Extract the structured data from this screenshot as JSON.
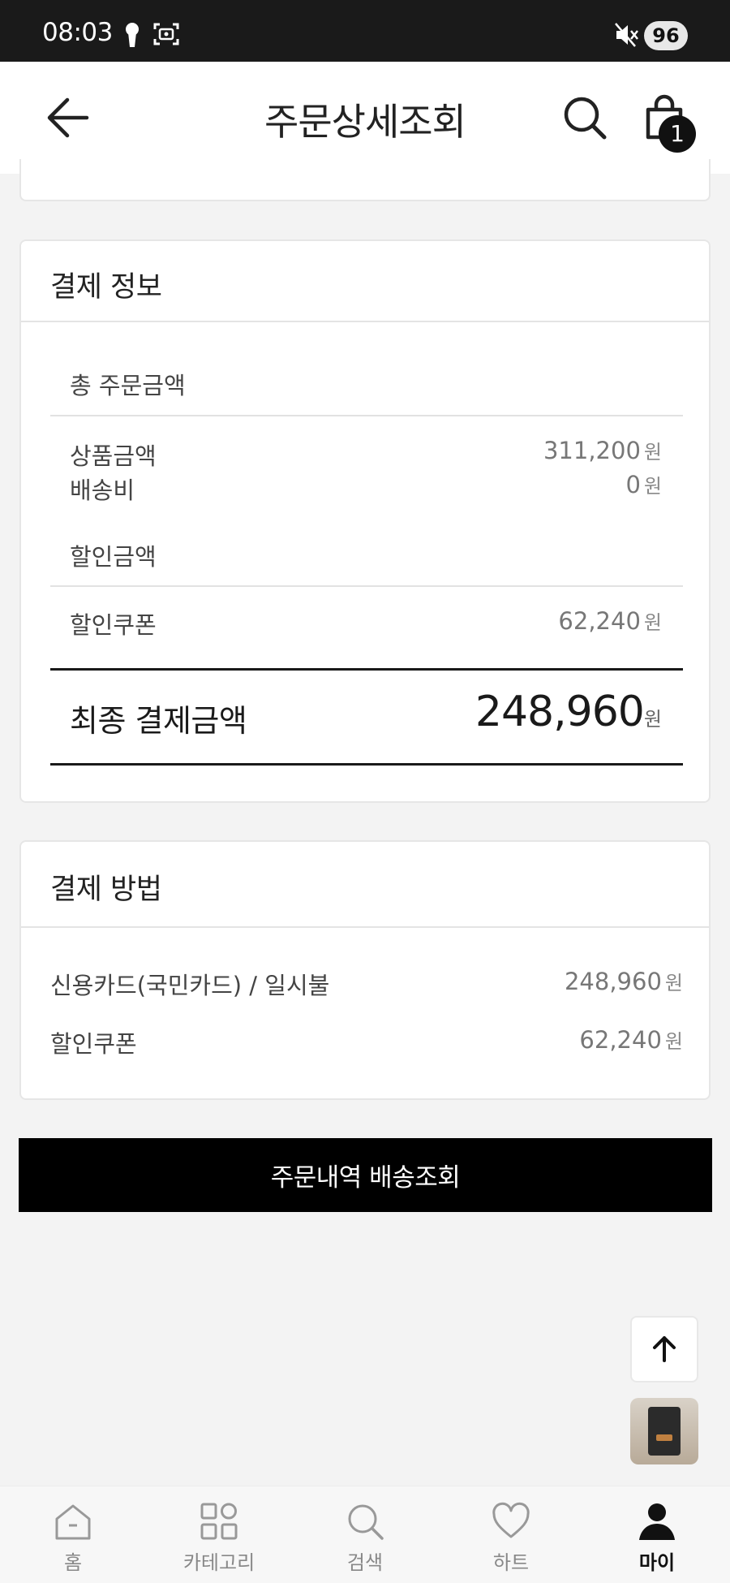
{
  "status_bar": {
    "time": "08:03",
    "battery": "96"
  },
  "header": {
    "title": "주문상세조회",
    "cart_count": "1"
  },
  "payment_info": {
    "title": "결제 정보",
    "total_order_label": "총 주문금액",
    "product_amount_label": "상품금액",
    "product_amount_value": "311,200",
    "shipping_label": "배송비",
    "shipping_value": "0",
    "discount_label": "할인금액",
    "coupon_label": "할인쿠폰",
    "coupon_value": "62,240",
    "unit": "원",
    "final_label": "최종 결제금액",
    "final_value": "248,960"
  },
  "payment_method": {
    "title": "결제 방법",
    "card_label": "신용카드(국민카드) / 일시불",
    "card_value": "248,960",
    "coupon_label": "할인쿠폰",
    "coupon_value": "62,240",
    "unit": "원"
  },
  "actions": {
    "delivery_button": "주문내역 배송조회"
  },
  "bottom_nav": [
    {
      "label": "홈",
      "icon": "home-icon"
    },
    {
      "label": "카테고리",
      "icon": "category-icon"
    },
    {
      "label": "검색",
      "icon": "search-icon"
    },
    {
      "label": "하트",
      "icon": "heart-icon"
    },
    {
      "label": "마이",
      "icon": "user-icon",
      "active": true
    }
  ],
  "colors": {
    "primary": "#000000",
    "background": "#f3f3f3",
    "muted_text": "#777777"
  }
}
